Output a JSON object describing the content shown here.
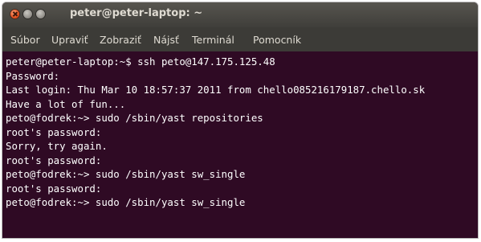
{
  "window": {
    "title": "peter@peter-laptop: ~"
  },
  "menu": [
    "Súbor",
    "Upraviť",
    "Zobraziť",
    "Nájsť",
    "Terminál",
    "Pomocník"
  ],
  "terminal": {
    "lines": [
      "peter@peter-laptop:~$ ssh peto@147.175.125.48",
      "Password:",
      "Last login: Thu Mar 10 18:57:37 2011 from chello085216179187.chello.sk",
      "Have a lot of fun...",
      "peto@fodrek:~> sudo /sbin/yast repositories",
      "root's password:",
      "Sorry, try again.",
      "root's password:",
      "peto@fodrek:~> sudo /sbin/yast sw_single",
      "root's password:",
      "peto@fodrek:~> sudo /sbin/yast sw_single"
    ]
  },
  "colors": {
    "terminal_background": "#2f0a24",
    "titlebar": "#4b4a45",
    "menubar": "#3c3b37",
    "text": "#ffffff",
    "close_button": "#e2511f"
  },
  "icons": [
    "close-icon",
    "minimize-icon",
    "maximize-icon"
  ]
}
